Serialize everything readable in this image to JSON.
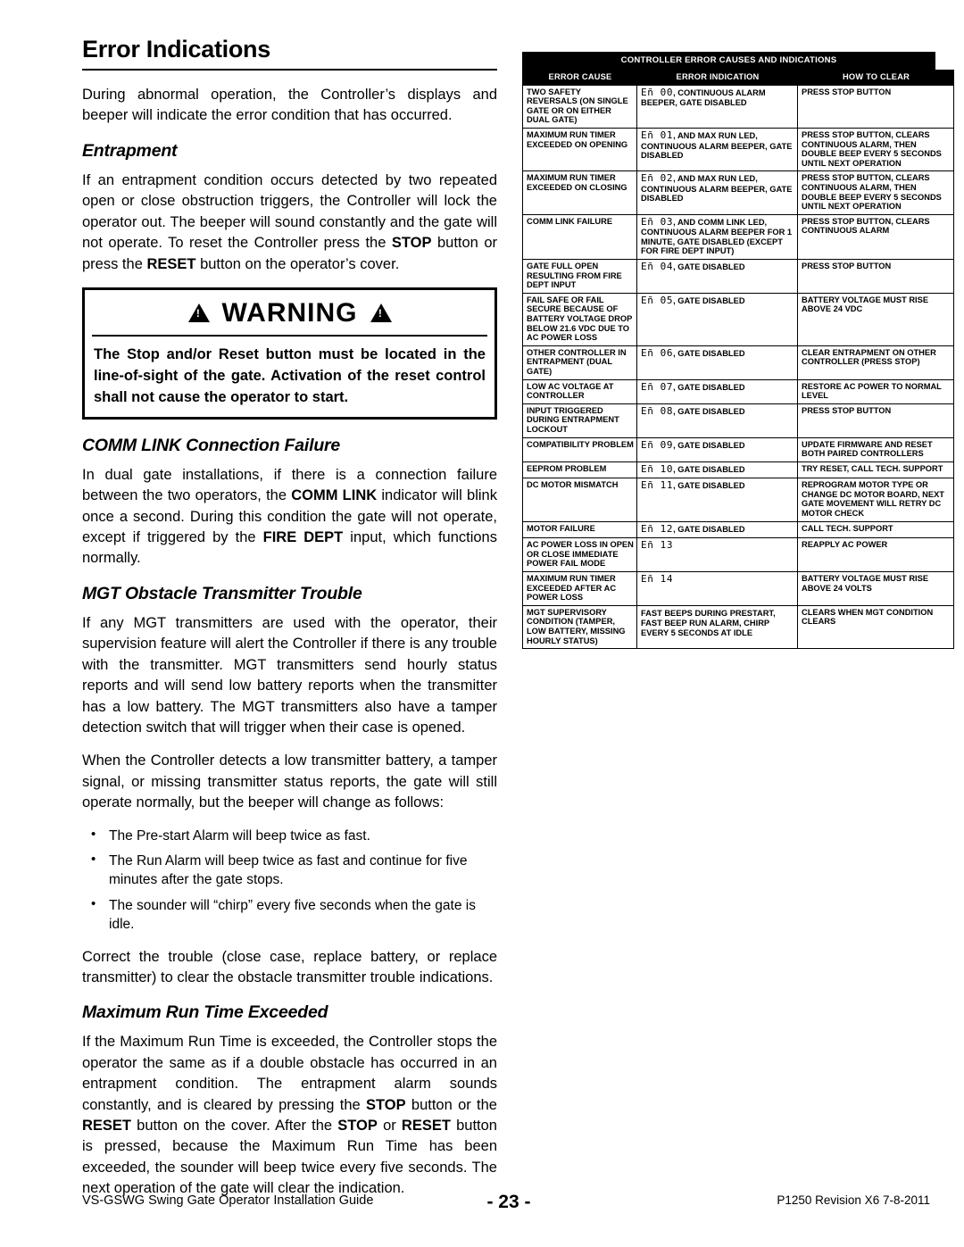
{
  "page": {
    "title": "Error Indications",
    "intro": "During abnormal operation, the Controller’s displays and beeper will indicate the error condition that has occurred."
  },
  "sections": {
    "entrapment": {
      "heading": "Entrapment",
      "p1_a": "If an entrapment condition occurs detected by two repeated open or close obstruction triggers, the Controller will lock the operator out. The beeper will sound constantly and the gate will not operate. To reset the Controller press the ",
      "p1_stop": "STOP",
      "p1_b": " button or press the ",
      "p1_reset": "RESET",
      "p1_c": " button on the operator’s cover."
    },
    "warning": {
      "label": "WARNING",
      "text": "The Stop and/or Reset button must be located in the line-of-sight of the gate. Activation of the reset control shall not cause the operator to start."
    },
    "comm_link": {
      "heading": "COMM LINK Connection Failure",
      "p1_a": "In dual gate installations, if there is a connection failure between the two operators, the ",
      "p1_comm": "COMM LINK",
      "p1_b": " indicator will blink once a second. During this condition the gate will not operate, except if triggered by the ",
      "p1_fire": "FIRE DEPT",
      "p1_c": " input, which functions normally."
    },
    "mgt": {
      "heading": "MGT Obstacle Transmitter Trouble",
      "p1": "If any MGT transmitters are used with the operator, their supervision feature will alert the Controller if there is any trouble with the transmitter. MGT transmitters send hourly status reports and will send low battery reports when the transmitter has a low battery. The MGT transmitters also have a tamper detection switch that will trigger when their case is opened.",
      "p2": "When the Controller detects a low transmitter battery, a tamper signal, or missing transmitter status reports, the gate will still operate normally, but the beeper will change as follows:",
      "bullets": [
        "The Pre-start Alarm will beep twice as fast.",
        "The Run Alarm will beep twice as fast and continue for five minutes after the gate stops.",
        "The sounder will “chirp” every five seconds when the gate is idle."
      ],
      "p3": "Correct the trouble (close case, replace battery, or replace transmitter) to clear the obstacle transmitter trouble indications."
    },
    "max_run": {
      "heading": "Maximum Run Time Exceeded",
      "p1_a": "If the Maximum Run Time is exceeded, the Controller stops the operator the same as if a double obstacle has occurred in an entrapment condition. The entrapment alarm sounds constantly, and is cleared by pressing the ",
      "p1_stop": "STOP",
      "p1_b": " button or the ",
      "p1_reset": "RESET",
      "p1_c": " button on the cover. After the ",
      "p1_stop2": "STOP",
      "p1_d": " or ",
      "p1_reset2": "RESET",
      "p1_e": " button is pressed, because the Maximum Run Time has been exceeded, the sounder will beep twice every five seconds. The next operation of the gate will clear the indication."
    }
  },
  "table": {
    "title": "CONTROLLER ERROR CAUSES AND INDICATIONS",
    "headers": [
      "ERROR CAUSE",
      "ERROR INDICATION",
      "HOW TO CLEAR"
    ],
    "rows": [
      {
        "cause": "TWO SAFETY REVERSALS (ON SINGLE GATE OR ON EITHER DUAL GATE)",
        "code": "Eñ 00",
        "indication_rest": ", CONTINUOUS ALARM BEEPER, GATE DISABLED",
        "clear": "PRESS STOP BUTTON"
      },
      {
        "cause": "MAXIMUM RUN TIMER EXCEEDED ON OPENING",
        "code": "Eñ 01",
        "indication_rest": ", AND MAX RUN LED, CONTINUOUS ALARM BEEPER, GATE DISABLED",
        "bold_word": "MAX RUN",
        "clear": "PRESS STOP BUTTON, CLEARS CONTINUOUS ALARM, THEN DOUBLE BEEP EVERY 5 SECONDS UNTIL NEXT OPERATION"
      },
      {
        "cause": "MAXIMUM RUN TIMER EXCEEDED ON CLOSING",
        "code": "Eñ 02",
        "indication_rest": ", AND MAX RUN LED, CONTINUOUS ALARM BEEPER, GATE DISABLED",
        "bold_word": "MAX RUN",
        "clear": "PRESS STOP BUTTON, CLEARS CONTINUOUS ALARM, THEN DOUBLE BEEP EVERY 5 SECONDS UNTIL NEXT OPERATION"
      },
      {
        "cause": "COMM LINK FAILURE",
        "code": "Eñ 03",
        "indication_rest": ", AND COMM LINK LED, CONTINUOUS ALARM BEEPER FOR 1 MINUTE, GATE DISABLED (EXCEPT FOR FIRE DEPT INPUT)",
        "bold_word": "COMM LINK",
        "clear": "PRESS STOP BUTTON, CLEARS CONTINUOUS ALARM"
      },
      {
        "cause": "GATE FULL OPEN RESULTING FROM FIRE DEPT INPUT",
        "code": "Eñ 04",
        "indication_rest": ", GATE DISABLED",
        "clear": "PRESS STOP BUTTON"
      },
      {
        "cause": "FAIL SAFE OR FAIL SECURE BECAUSE OF BATTERY VOLTAGE DROP BELOW 21.6 VDC DUE TO AC POWER LOSS",
        "code": "Eñ 05",
        "indication_rest": ", GATE DISABLED",
        "clear": "BATTERY VOLTAGE MUST RISE ABOVE 24 VDC"
      },
      {
        "cause": "OTHER CONTROLLER IN ENTRAPMENT (DUAL GATE)",
        "code": "Eñ 06",
        "indication_rest": ", GATE DISABLED",
        "clear": "CLEAR ENTRAPMENT ON OTHER CONTROLLER (PRESS STOP)"
      },
      {
        "cause": "LOW AC VOLTAGE AT CONTROLLER",
        "code": "Eñ 07",
        "indication_rest": ", GATE DISABLED",
        "clear": "RESTORE AC POWER TO NORMAL LEVEL"
      },
      {
        "cause": "INPUT TRIGGERED DURING ENTRAPMENT LOCKOUT",
        "code": "Eñ 08",
        "indication_rest": ", GATE DISABLED",
        "clear": "PRESS STOP BUTTON"
      },
      {
        "cause": "COMPATIBILITY PROBLEM",
        "code": "Eñ 09",
        "indication_rest": ", GATE DISABLED",
        "clear": "UPDATE FIRMWARE AND RESET BOTH PAIRED CONTROLLERS"
      },
      {
        "cause": "EEPROM PROBLEM",
        "code": "Eñ 10",
        "indication_rest": ", GATE DISABLED",
        "clear": "TRY RESET, CALL TECH. SUPPORT"
      },
      {
        "cause": "DC MOTOR MISMATCH",
        "code": "Eñ 11",
        "indication_rest": ", GATE DISABLED",
        "clear": "REPROGRAM MOTOR TYPE OR CHANGE DC MOTOR BOARD, NEXT GATE MOVEMENT WILL RETRY DC MOTOR CHECK"
      },
      {
        "cause": "MOTOR FAILURE",
        "code": "Eñ 12",
        "indication_rest": ", GATE DISABLED",
        "clear": "CALL TECH. SUPPORT"
      },
      {
        "cause": "AC POWER LOSS IN OPEN OR CLOSE IMMEDIATE POWER FAIL MODE",
        "code": "Eñ 13",
        "indication_rest": "",
        "clear": "REAPPLY AC POWER"
      },
      {
        "cause": "MAXIMUM RUN TIMER EXCEEDED AFTER AC POWER LOSS",
        "code": "Eñ 14",
        "indication_rest": "",
        "clear": "BATTERY VOLTAGE MUST RISE ABOVE 24 VOLTS"
      },
      {
        "cause": "MGT SUPERVISORY CONDITION (TAMPER, LOW BATTERY, MISSING HOURLY STATUS)",
        "code": "",
        "indication_rest": "FAST BEEPS DURING PRESTART, FAST BEEP RUN ALARM, CHIRP EVERY 5 SECONDS AT IDLE",
        "clear": "CLEARS WHEN MGT CONDITION CLEARS"
      }
    ]
  },
  "footer": {
    "left": "VS-GSWG  Swing Gate Operator Installation Guide",
    "center": "- 23 -",
    "right": "P1250 Revision X6 7-8-2011"
  }
}
